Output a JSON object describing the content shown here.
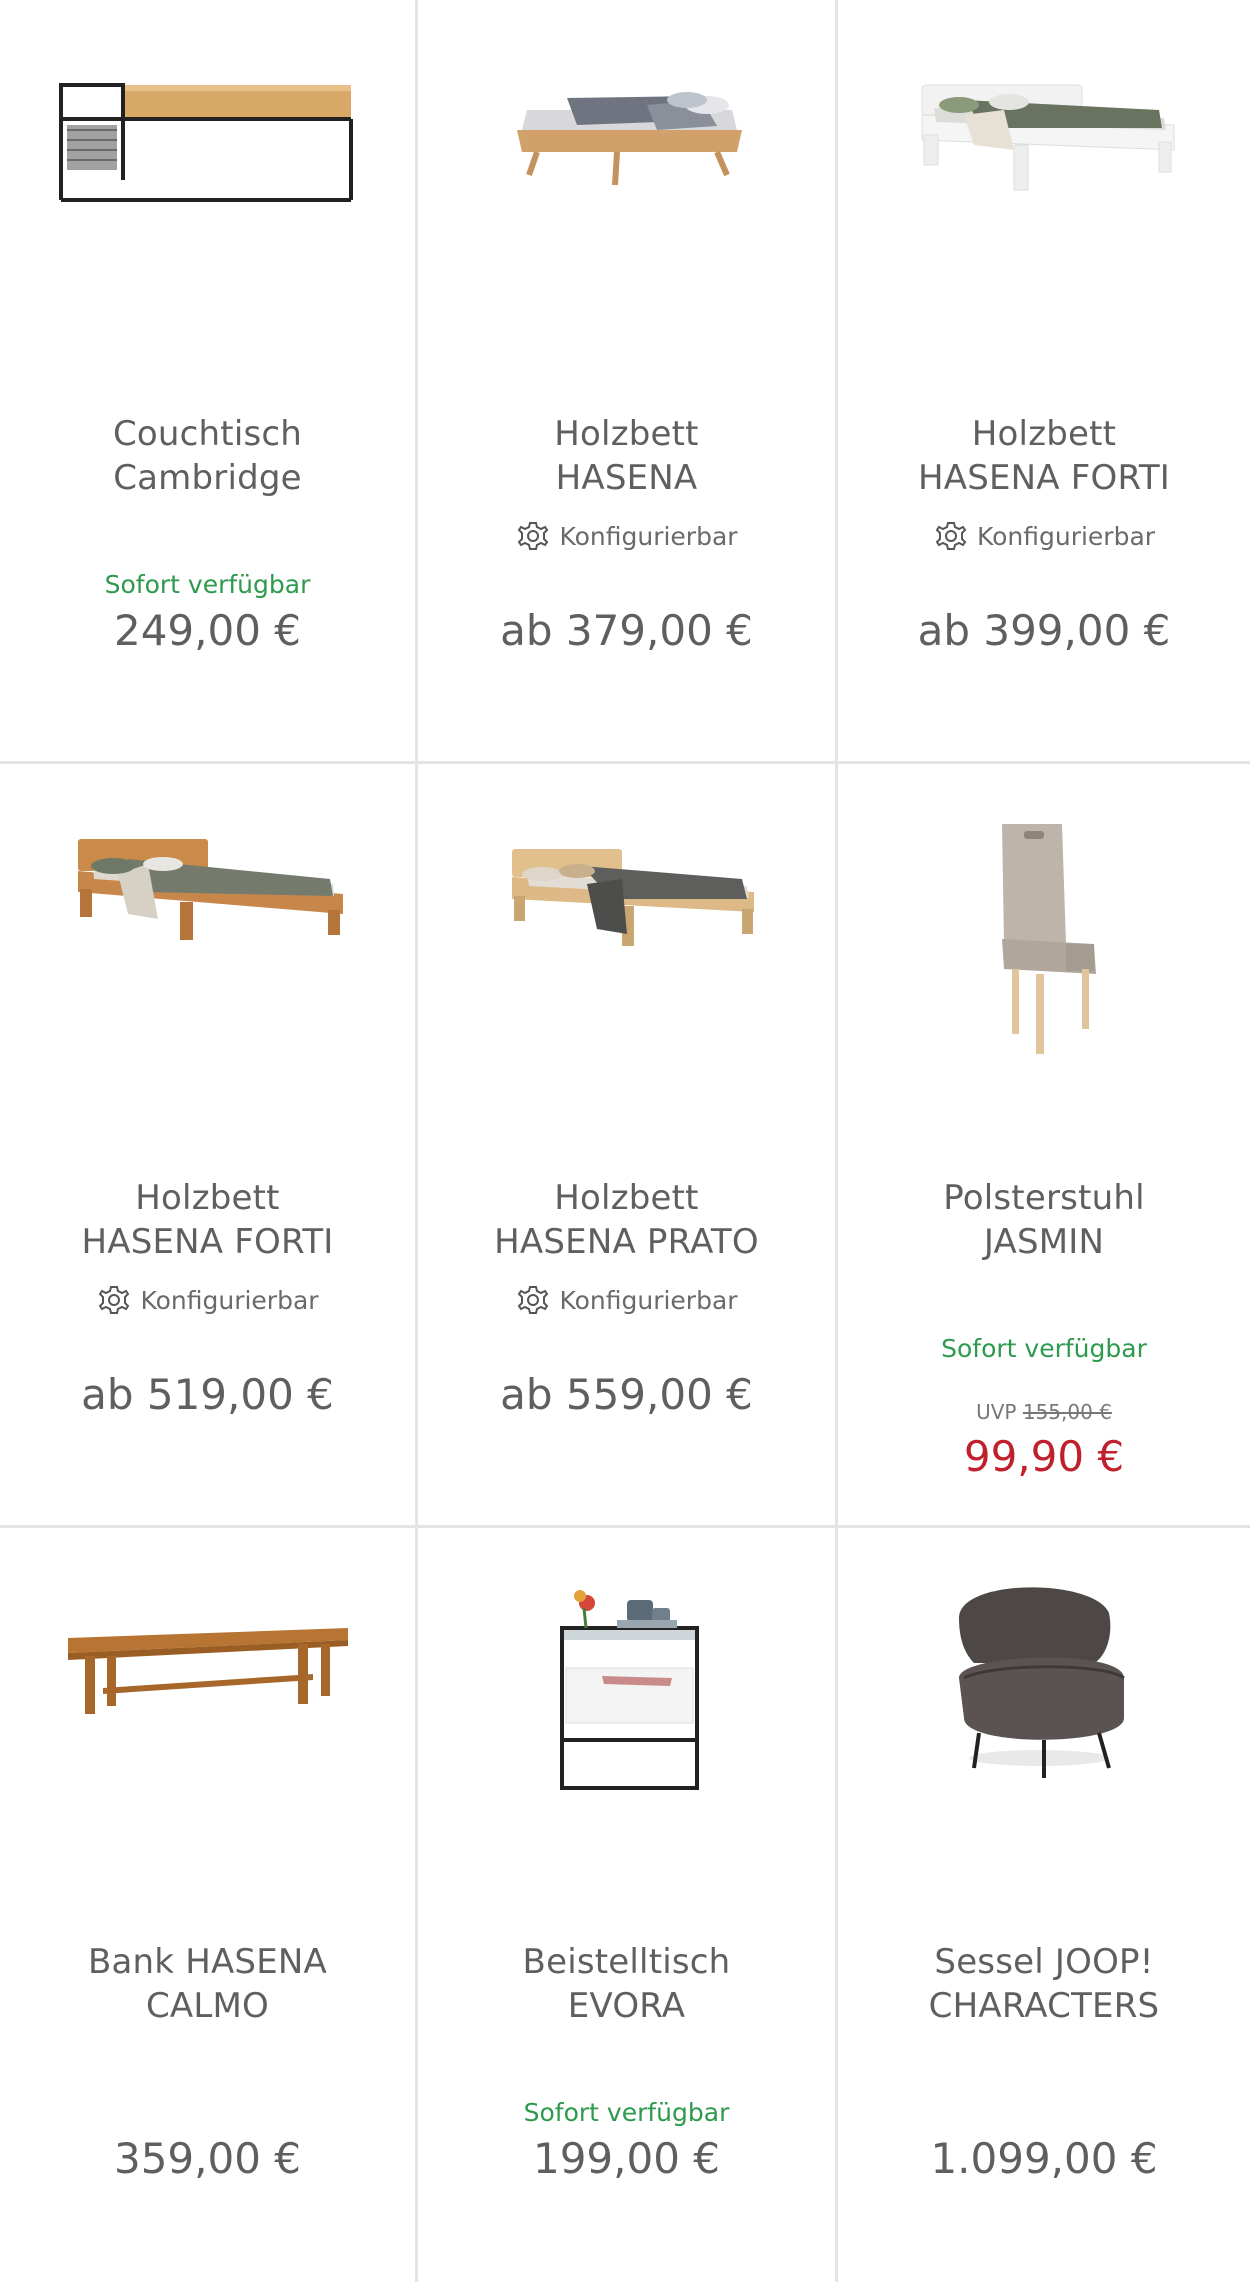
{
  "products": [
    {
      "title_line1": "Couchtisch",
      "title_line2": "Cambridge",
      "configurable": "",
      "availability": "Sofort verfügbar",
      "price": "249,00 €"
    },
    {
      "title_line1": "Holzbett",
      "title_line2": "HASENA",
      "configurable": "Konfigurierbar",
      "availability": "",
      "price": "ab 379,00 €"
    },
    {
      "title_line1": "Holzbett",
      "title_line2": "HASENA FORTI",
      "configurable": "Konfigurierbar",
      "availability": "",
      "price": "ab 399,00 €"
    },
    {
      "title_line1": "Holzbett",
      "title_line2": "HASENA FORTI",
      "configurable": "Konfigurierbar",
      "availability": "",
      "price": "ab 519,00 €"
    },
    {
      "title_line1": "Holzbett",
      "title_line2": "HASENA PRATO",
      "configurable": "Konfigurierbar",
      "availability": "",
      "price": "ab 559,00 €"
    },
    {
      "title_line1": "Polsterstuhl",
      "title_line2": "JASMIN",
      "configurable": "",
      "availability": "Sofort verfügbar",
      "uvp_label": "UVP",
      "uvp_price": "155,00 €",
      "price": "99,90 €"
    },
    {
      "title_line1": "Bank HASENA",
      "title_line2": "CALMO",
      "configurable": "",
      "availability": "",
      "price": "359,00 €"
    },
    {
      "title_line1": "Beistelltisch",
      "title_line2": "EVORA",
      "configurable": "",
      "availability": "Sofort verfügbar",
      "price": "199,00 €"
    },
    {
      "title_line1": "Sessel JOOP!",
      "title_line2": "CHARACTERS",
      "configurable": "",
      "availability": "",
      "price": "1.099,00 €"
    }
  ],
  "colors": {
    "availability": "#2e9a4e",
    "sale_price": "#c0202b",
    "text": "#5f5f5f",
    "divider": "#e4e4e4"
  },
  "icons": {
    "configurable": "gear-icon"
  }
}
